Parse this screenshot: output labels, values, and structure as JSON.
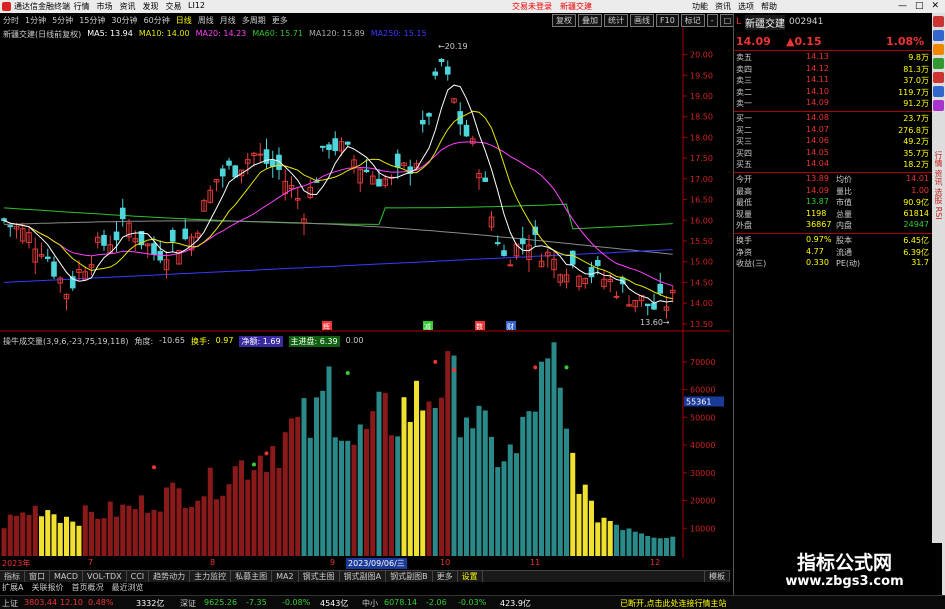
{
  "titlebar": {
    "app_title": "通达信金融终端",
    "menus": [
      "行情",
      "市场",
      "资讯",
      "发现",
      "交易",
      "LI12"
    ],
    "notice": "交易未登录",
    "stock_name": "新疆交建",
    "right_menus": [
      "功能",
      "资讯",
      "选项",
      "帮助"
    ],
    "win_buttons": [
      "—",
      "□",
      "✕"
    ]
  },
  "periods": [
    "分时",
    "1分钟",
    "5分钟",
    "15分钟",
    "30分钟",
    "60分钟",
    "日线",
    "周线",
    "月线",
    "多周期",
    "更多"
  ],
  "active_period": "日线",
  "tools": [
    "复权",
    "叠加",
    "统计",
    "画线",
    "F10",
    "标记",
    "-",
    "□"
  ],
  "ma_legend": {
    "name": "新疆交建(日线前复权)",
    "ma5": "MA5: 13.94",
    "ma10": "MA10: 14.00",
    "ma20": "MA20: 14.23",
    "ma60": "MA60: 15.71",
    "ma120": "MA120: 15.89",
    "ma250": "MA250: 15.15"
  },
  "price_axis": [
    "20.00",
    "19.50",
    "19.00",
    "18.50",
    "18.00",
    "17.50",
    "17.00",
    "16.50",
    "16.00",
    "15.50",
    "15.00",
    "14.50",
    "14.00",
    "13.50"
  ],
  "high_label": "20.19",
  "low_label": "13.60",
  "event_markers": [
    "辉",
    "减",
    "数",
    "财"
  ],
  "indicator_legend": {
    "name": "操牛成交量(3,9,6,-23,75,19,118)",
    "angle_label": "角度:",
    "angle_value": "-10.65",
    "turnover_label": "换手:",
    "turnover_value": "0.97",
    "tag1": "净额: 1.69",
    "tag2": "主进盘: 6.39",
    "tag3": "0.00"
  },
  "vol_axis": [
    "70000",
    "60000",
    "50000",
    "40000",
    "30000",
    "20000",
    "10000"
  ],
  "vol_current": "55361",
  "dates": {
    "m1": "2023年",
    "m2": "7",
    "m3": "8",
    "m4": "9",
    "cursor": "2023/09/06/三",
    "m5": "10",
    "m6": "11",
    "m7": "12"
  },
  "tabs": [
    "指标",
    "窗口",
    "MACD",
    "VOL-TDX",
    "CCI",
    "趋势动力",
    "主力监控",
    "私募主图",
    "MA2",
    "钢式主图",
    "钢式副图A",
    "钢式副图B",
    "更多",
    "设置"
  ],
  "tab_end": "模板",
  "exten": [
    "扩展A",
    "关联报价",
    "首页概况",
    "最近浏览"
  ],
  "quote": {
    "name": "新疆交建",
    "code": "002941",
    "price": "14.09",
    "change": "▲0.15",
    "pct": "1.08%",
    "asks": [
      [
        "卖五",
        "14.13",
        "9.8万"
      ],
      [
        "卖四",
        "14.12",
        "81.3万"
      ],
      [
        "卖三",
        "14.11",
        "37.0万"
      ],
      [
        "卖二",
        "14.10",
        "119.7万"
      ],
      [
        "卖一",
        "14.09",
        "91.2万"
      ]
    ],
    "bids": [
      [
        "买一",
        "14.08",
        "23.7万"
      ],
      [
        "买二",
        "14.07",
        "276.8万"
      ],
      [
        "买三",
        "14.06",
        "49.2万"
      ],
      [
        "买四",
        "14.05",
        "35.7万"
      ],
      [
        "买五",
        "14.04",
        "18.2万"
      ]
    ],
    "stats": [
      [
        "今开",
        "13.89",
        "均价",
        "14.01"
      ],
      [
        "最高",
        "14.09",
        "量比",
        "1.00"
      ],
      [
        "最低",
        "13.87",
        "市值",
        "90.9亿"
      ],
      [
        "现量",
        "1198",
        "总量",
        "61814"
      ],
      [
        "外盘",
        "36867",
        "内盘",
        "24947"
      ]
    ],
    "stats2": [
      [
        "换手",
        "0.97%",
        "股本",
        "6.45亿"
      ],
      [
        "净资",
        "4.77",
        "流通",
        "6.39亿"
      ],
      [
        "收益(三)",
        "0.330",
        "PE(动)",
        "31.7"
      ]
    ]
  },
  "status": [
    [
      "上证",
      "3803.44"
    ],
    [
      "12.10",
      "0.48%"
    ],
    [
      "3332亿",
      ""
    ],
    [
      "深证",
      "9625.26"
    ],
    [
      "-7.35",
      "-0.08%"
    ],
    [
      "4543亿",
      ""
    ],
    [
      "中小",
      "6078.14"
    ],
    [
      "-2.06",
      "-0.03%"
    ],
    [
      "423.9亿",
      ""
    ],
    [
      "已断开,点击此处连接行情主站",
      ""
    ]
  ],
  "watermark": {
    "line1": "指标公式网",
    "line2": "www.zbgs3.com"
  },
  "sidebar_labels": [
    "行情",
    "资讯",
    "选股",
    "RSI"
  ],
  "colors": {
    "up": "#e33b3b",
    "down": "#4fd6dc",
    "ma5": "#ffffff",
    "ma10": "#e6e600",
    "ma20": "#ff40ff",
    "ma60": "#30c030",
    "ma120": "#8a8a8a",
    "ma250": "#3a3aff"
  }
}
